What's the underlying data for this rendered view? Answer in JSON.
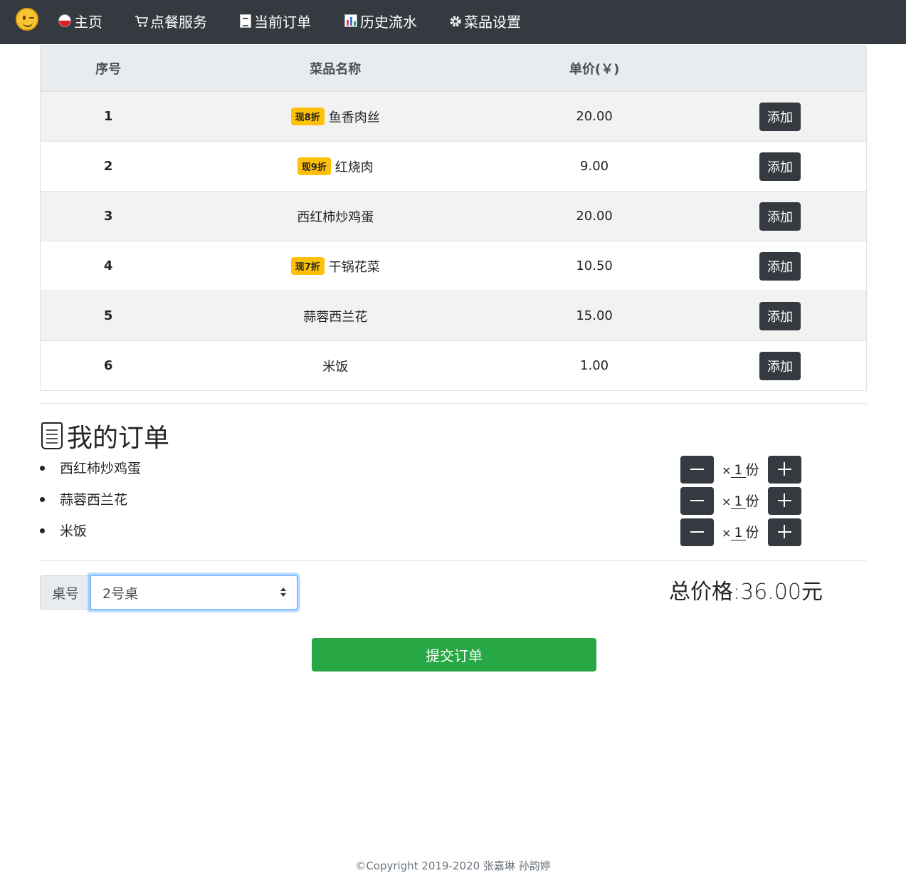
{
  "nav": {
    "items": [
      {
        "label": "主页"
      },
      {
        "label": "点餐服务"
      },
      {
        "label": "当前订单"
      },
      {
        "label": "历史流水"
      },
      {
        "label": "菜品设置"
      }
    ]
  },
  "menu": {
    "headers": {
      "index": "序号",
      "name": "菜品名称",
      "price": "单价(￥)"
    },
    "add_label": "添加",
    "rows": [
      {
        "index": "1",
        "badge": "现8折",
        "name": "鱼香肉丝",
        "price": "20.00"
      },
      {
        "index": "2",
        "badge": "现9折",
        "name": "红烧肉",
        "price": "9.00"
      },
      {
        "index": "3",
        "badge": "",
        "name": "西红柿炒鸡蛋",
        "price": "20.00"
      },
      {
        "index": "4",
        "badge": "现7折",
        "name": "干锅花菜",
        "price": "10.50"
      },
      {
        "index": "5",
        "badge": "",
        "name": "蒜蓉西兰花",
        "price": "15.00"
      },
      {
        "index": "6",
        "badge": "",
        "name": "米饭",
        "price": "1.00"
      }
    ]
  },
  "order": {
    "title": "我的订单",
    "times": "×",
    "unit": "份",
    "items": [
      {
        "name": "西红柿炒鸡蛋",
        "qty": "1"
      },
      {
        "name": "蒜蓉西兰花",
        "qty": "1"
      },
      {
        "name": "米饭",
        "qty": "1"
      }
    ]
  },
  "table_select": {
    "label": "桌号",
    "value": "2号桌"
  },
  "total": "总价格:36.00元",
  "submit_label": "提交订单",
  "footer": "©Copyright 2019-2020 张嘉琳 孙韵婷",
  "colors": {
    "navbar": "#343a40",
    "badge": "#ffc107",
    "submit": "#28a745"
  }
}
